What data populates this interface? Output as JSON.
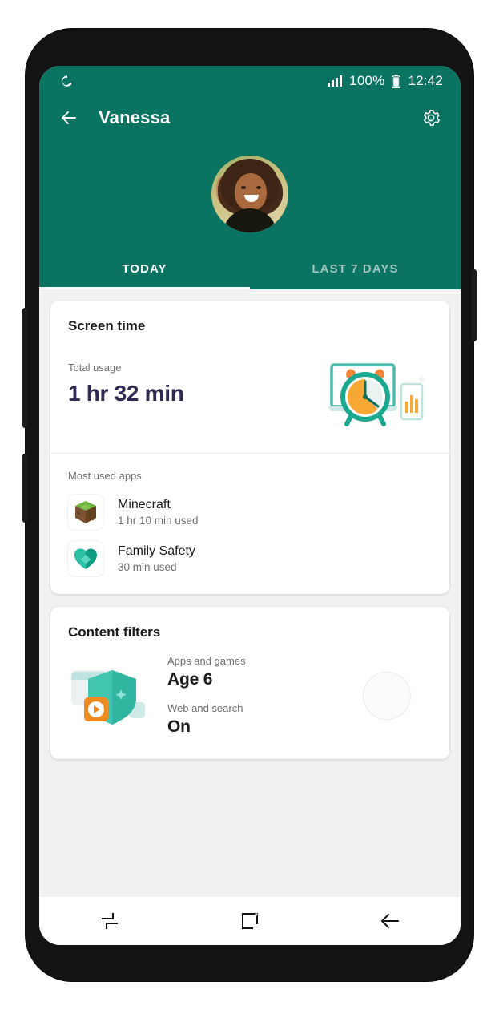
{
  "statusbar": {
    "dnd_icon": "crescent-moon-icon",
    "signal_icon": "signal-bars-icon",
    "battery_percent": "100%",
    "battery_icon": "battery-full-icon",
    "time": "12:42"
  },
  "appbar": {
    "back_icon": "back-arrow-icon",
    "title": "Vanessa",
    "settings_icon": "gear-icon"
  },
  "hero": {
    "avatar_name": "child-profile-photo"
  },
  "tabs": [
    {
      "label": "TODAY",
      "active": true
    },
    {
      "label": "LAST 7 DAYS",
      "active": false
    }
  ],
  "screen_time_card": {
    "title": "Screen time",
    "total_usage_label": "Total usage",
    "total_usage_value": "1 hr 32 min",
    "illustration": "laptop-alarm-clock-chart-illustration",
    "most_used_label": "Most used apps",
    "apps": [
      {
        "name": "Minecraft",
        "usage": "1 hr 10 min used",
        "icon": "minecraft-grass-block-icon"
      },
      {
        "name": "Family Safety",
        "usage": "30 min used",
        "icon": "family-safety-heart-icon"
      }
    ]
  },
  "content_filters_card": {
    "title": "Content filters",
    "illustration": "shield-play-button-illustration",
    "apps_games_label": "Apps and games",
    "apps_games_value": "Age 6",
    "web_search_label": "Web and search",
    "web_search_value": "On",
    "ripple": "loading-circle"
  },
  "navbar": {
    "recents_icon": "recents-icon",
    "home_icon": "home-square-icon",
    "back_icon": "back-arrow-icon"
  },
  "colors": {
    "brand_teal": "#0A7361",
    "accent_orange": "#F59A23",
    "accent_teal": "#3BB6A4",
    "value_navy": "#2F2A52",
    "screen_bg": "#F1F1F0"
  }
}
